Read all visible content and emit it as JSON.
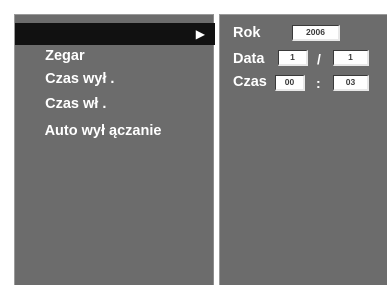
{
  "menu": {
    "items": [
      {
        "label": "Zegar",
        "selected": true
      },
      {
        "label": "Czas wył ."
      },
      {
        "label": "Czas wł ."
      },
      {
        "label": "Auto wył ączanie"
      }
    ],
    "selected_arrow": "▶"
  },
  "clock": {
    "year_label": "Rok",
    "year_value": "2006",
    "date_label": "Data",
    "day_value": "1",
    "date_separator": "/",
    "month_value": "1",
    "time_label": "Czas",
    "hour_value": "00",
    "time_separator": ":",
    "minute_value": "03"
  },
  "colors": {
    "panel": "#6c6c6c",
    "selected": "#111111",
    "text": "#ffffff"
  }
}
